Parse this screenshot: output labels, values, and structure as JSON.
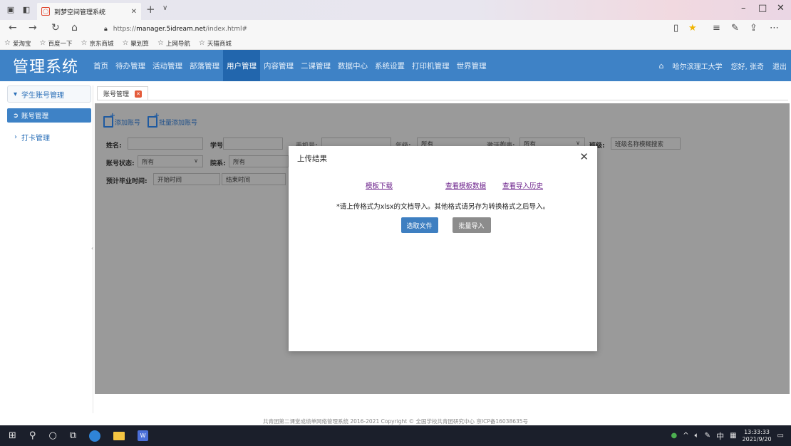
{
  "browser": {
    "tab_title": "到梦空间管理系统",
    "url_prefix": "https://",
    "url_host": "manager.5idream.net",
    "url_path": "/index.html#",
    "favorites": [
      "爱淘宝",
      "百度一下",
      "京东商城",
      "聚划算",
      "上网导航",
      "天猫商城"
    ]
  },
  "app": {
    "logo": "管理系统",
    "nav": [
      "首页",
      "待办管理",
      "活动管理",
      "部落管理",
      "用户管理",
      "内容管理",
      "二课管理",
      "数据中心",
      "系统设置",
      "打印机管理",
      "世界管理"
    ],
    "active_nav_index": 4,
    "school": "哈尔滨理工大学",
    "greeting": "您好, 张奇",
    "logout": "退出"
  },
  "sidebar": {
    "group": "学生账号管理",
    "active_item": "账号管理",
    "sub_item": "打卡管理"
  },
  "content": {
    "tab_label": "账号管理",
    "toolbar": {
      "add": "添加账号",
      "batch_add": "批量添加账号"
    },
    "filters": {
      "name_label": "姓名:",
      "student_no_label": "学号:",
      "phone_label": "手机号:",
      "grade_label": "年级:",
      "grade_value": "所有",
      "active_label": "激活列表:",
      "active_value": "所有",
      "class_label": "班级:",
      "class_placeholder": "班级名称模糊搜索",
      "status_label": "账号状态:",
      "status_value": "所有",
      "dept_label": "院系:",
      "dept_value": "所有",
      "grad_label": "预计毕业时间:",
      "start_placeholder": "开始时间",
      "end_placeholder": "结束时间"
    }
  },
  "modal": {
    "title": "上传结果",
    "links": [
      "模板下载",
      "查看模板数据",
      "查看导入历史"
    ],
    "note": "*请上传格式为xlsx的文档导入。其他格式请另存为转换格式之后导入。",
    "select_button": "选取文件",
    "import_button": "批量导入"
  },
  "footer": "共青团第二课堂成绩单网络管理系统    2016-2021 Copyright © 全国学校共青团研究中心  京ICP备16038635号",
  "taskbar": {
    "ime": "中",
    "time": "13:33:33",
    "date": "2021/9/20"
  },
  "colors": {
    "header": "#3e82c6",
    "header_active": "#2266ad",
    "overlay": "#9a9a9a",
    "primary_button": "#3e7fc1"
  }
}
